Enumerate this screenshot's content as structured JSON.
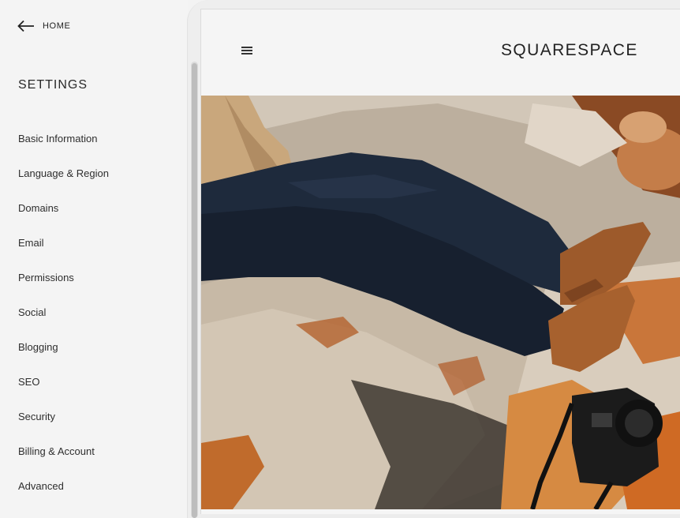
{
  "sidebar": {
    "home_label": "HOME",
    "title": "SETTINGS",
    "items": [
      {
        "label": "Basic Information"
      },
      {
        "label": "Language & Region"
      },
      {
        "label": "Domains"
      },
      {
        "label": "Email"
      },
      {
        "label": "Permissions"
      },
      {
        "label": "Social"
      },
      {
        "label": "Blogging"
      },
      {
        "label": "SEO"
      },
      {
        "label": "Security"
      },
      {
        "label": "Billing & Account"
      },
      {
        "label": "Advanced"
      }
    ]
  },
  "preview": {
    "site_title": "SQUARESPACE",
    "hero_image": "person-in-jeans-on-rocks-with-camera"
  }
}
